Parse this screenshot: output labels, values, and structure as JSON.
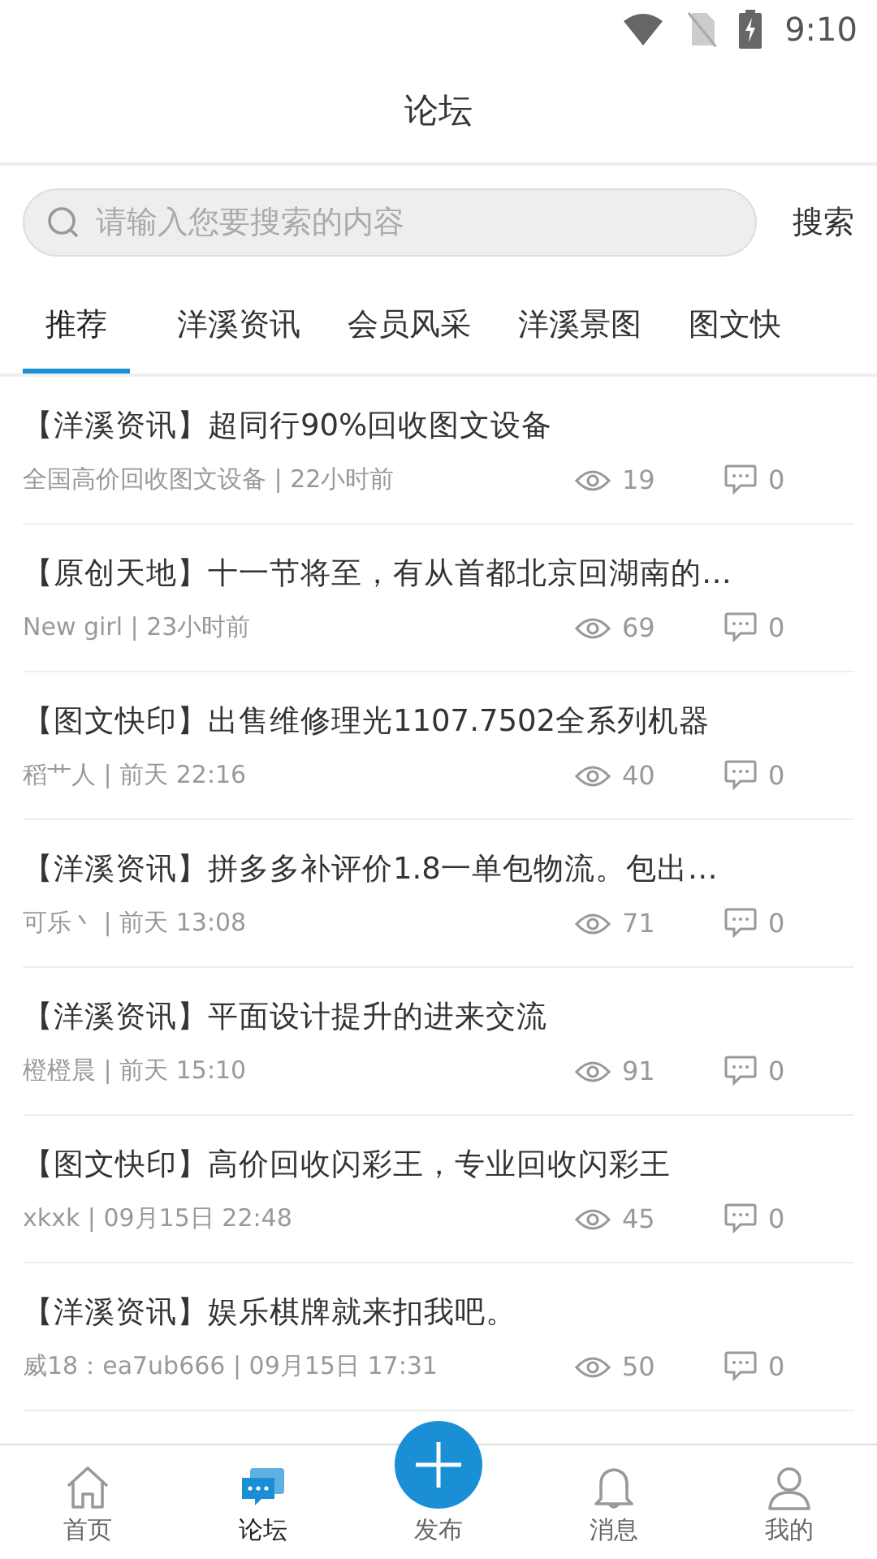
{
  "status_bar": {
    "time": "9:10"
  },
  "header": {
    "title": "论坛"
  },
  "search": {
    "placeholder": "请输入您要搜索的内容",
    "button": "搜索"
  },
  "tabs": [
    {
      "label": "推荐",
      "selected": true
    },
    {
      "label": "洋溪资讯",
      "selected": false
    },
    {
      "label": "会员风采",
      "selected": false
    },
    {
      "label": "洋溪景图",
      "selected": false
    },
    {
      "label": "图文快",
      "selected": false
    }
  ],
  "posts": [
    {
      "title": "【洋溪资讯】超同行90%回收图文设备",
      "meta": "全国高价回收图文设备 | 22小时前",
      "views": "19",
      "comments": "0"
    },
    {
      "title": "【原创天地】十一节将至，有从首都北京回湖南的…",
      "meta": "New girl | 23小时前",
      "views": "69",
      "comments": "0"
    },
    {
      "title": "【图文快印】出售维修理光1107.7502全系列机器",
      "meta": "稻艹人 | 前天 22:16",
      "views": "40",
      "comments": "0"
    },
    {
      "title": "【洋溪资讯】拼多多补评价1.8一单包物流。包出…",
      "meta": "可乐丶 | 前天 13:08",
      "views": "71",
      "comments": "0"
    },
    {
      "title": "【洋溪资讯】平面设计提升的进来交流",
      "meta": "橙橙晨 | 前天 15:10",
      "views": "91",
      "comments": "0"
    },
    {
      "title": "【图文快印】高价回收闪彩王，专业回收闪彩王",
      "meta": "xkxk | 09月15日 22:48",
      "views": "45",
      "comments": "0"
    },
    {
      "title": "【洋溪资讯】娱乐棋牌就来扣我吧。",
      "meta": "威18：ea7ub666 | 09月15日 17:31",
      "views": "50",
      "comments": "0"
    }
  ],
  "bottom_nav": [
    {
      "kind": "home",
      "label": "首页",
      "selected": false
    },
    {
      "kind": "forum",
      "label": "论坛",
      "selected": true
    },
    {
      "kind": "publish",
      "label": "发布",
      "selected": false
    },
    {
      "kind": "bell",
      "label": "消息",
      "selected": false
    },
    {
      "kind": "person",
      "label": "我的",
      "selected": false
    }
  ]
}
